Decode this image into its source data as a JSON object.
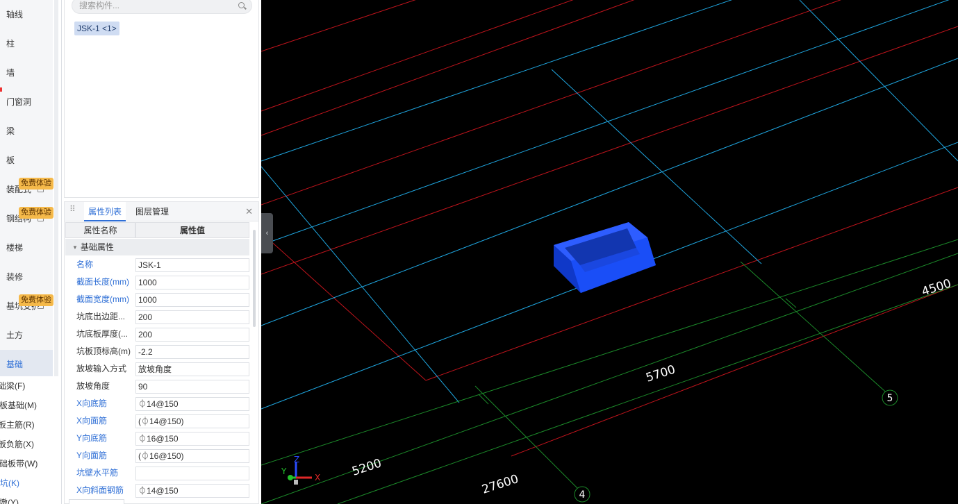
{
  "nav": {
    "items": [
      {
        "label": "轴线"
      },
      {
        "label": "柱"
      },
      {
        "label": "墙"
      },
      {
        "label": "门窗洞"
      },
      {
        "label": "梁"
      },
      {
        "label": "板"
      },
      {
        "label": "装配式",
        "badge": "免费体验"
      },
      {
        "label": "钢结构",
        "badge": "免费体验"
      },
      {
        "label": "楼梯"
      },
      {
        "label": "装修"
      },
      {
        "label": "基坑支护",
        "badge": "免费体验"
      },
      {
        "label": "土方"
      },
      {
        "label": "基础"
      }
    ],
    "sub_items": [
      {
        "label": "基础梁(F)"
      },
      {
        "label": "筏板基础(M)"
      },
      {
        "label": "筏板主筋(R)"
      },
      {
        "label": "筏板负筋(X)"
      },
      {
        "label": "基础板带(W)"
      },
      {
        "label": "集水坑(K)"
      },
      {
        "label": "柱墩(Y)"
      }
    ]
  },
  "component_panel": {
    "search_placeholder": "搜索构件...",
    "selected_item": "JSK-1 <1>"
  },
  "property_panel": {
    "tabs": [
      {
        "label": "属性列表"
      },
      {
        "label": "图层管理"
      }
    ],
    "close_symbol": "✕",
    "header_name": "属性名称",
    "header_value": "属性值",
    "group_label": "基础属性",
    "rows": [
      {
        "name": "名称",
        "value": "JSK-1",
        "blue": true
      },
      {
        "name": "截面长度(mm)",
        "value": "1000",
        "blue": true
      },
      {
        "name": "截面宽度(mm)",
        "value": "1000",
        "blue": true
      },
      {
        "name": "坑底出边距...",
        "value": "200",
        "blue": false
      },
      {
        "name": "坑底板厚度(...",
        "value": "200",
        "blue": false
      },
      {
        "name": "坑板顶标高(m)",
        "value": "-2.2",
        "blue": false
      },
      {
        "name": "放坡输入方式",
        "value": "放坡角度",
        "blue": false
      },
      {
        "name": "放坡角度",
        "value": "90",
        "blue": false
      },
      {
        "name": "X向底筋",
        "value": "⏀14@150",
        "blue": true
      },
      {
        "name": "X向面筋",
        "value": "(⏀14@150)",
        "blue": true
      },
      {
        "name": "Y向底筋",
        "value": "⏀16@150",
        "blue": true
      },
      {
        "name": "Y向面筋",
        "value": "(⏀16@150)",
        "blue": true
      },
      {
        "name": "坑壁水平筋",
        "value": "",
        "blue": true
      },
      {
        "name": "X向斜面钢筋",
        "value": "⏀14@150",
        "blue": true
      }
    ]
  },
  "viewport": {
    "dimensions": [
      "4500",
      "5700",
      "5200",
      "27600"
    ],
    "axis_numbers": [
      "5",
      "4"
    ],
    "triad": {
      "x": "X",
      "y": "Y",
      "z": "Z"
    },
    "colors": {
      "background": "#000000",
      "grid_blue": "#1fa6e0",
      "grid_red": "#c0141c",
      "grid_green": "#1c8a2a",
      "pit_blue": "#1547f0"
    }
  }
}
